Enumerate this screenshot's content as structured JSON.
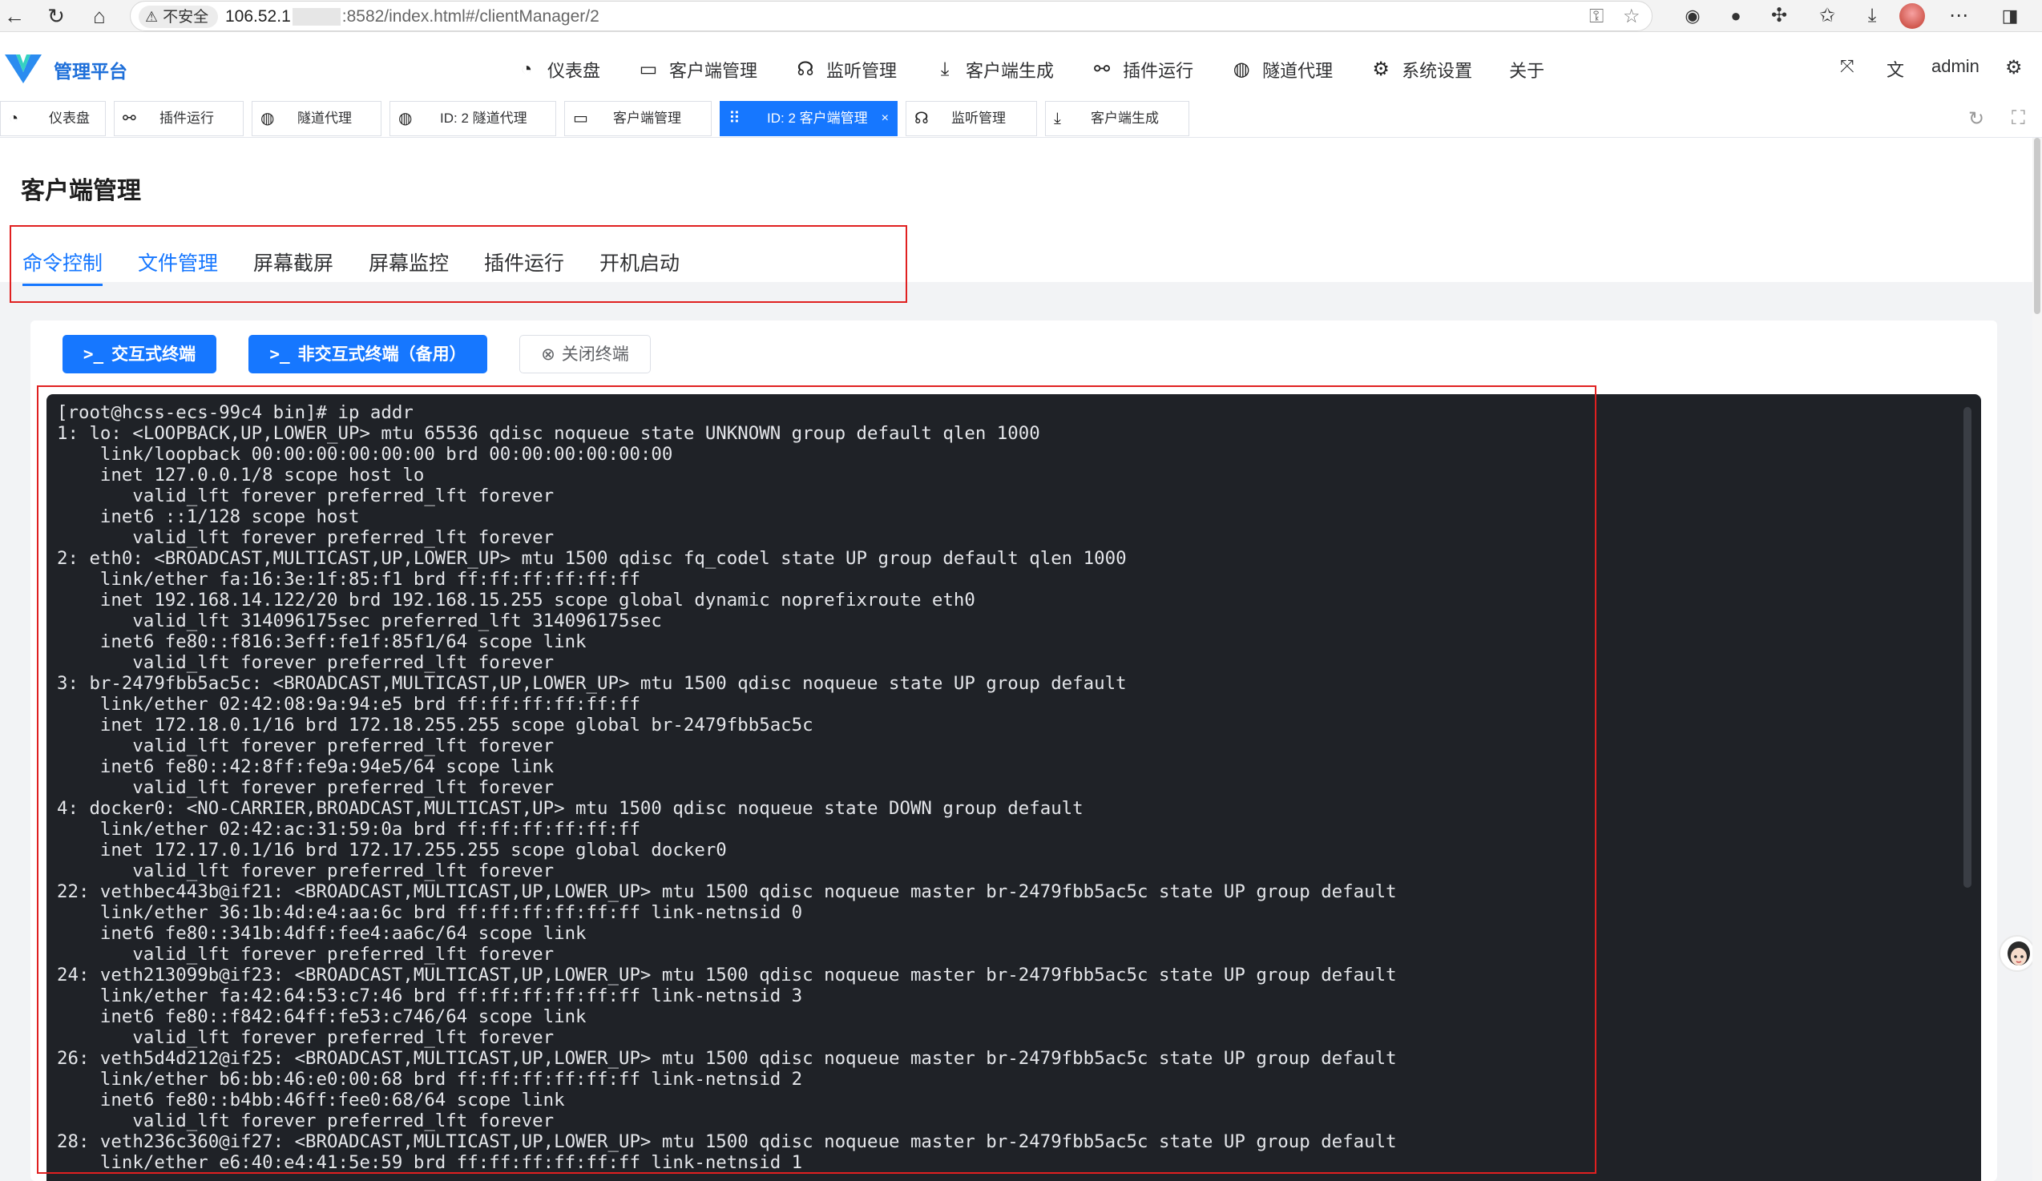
{
  "browser": {
    "security_label": "不安全",
    "url_host": "106.52.1",
    "url_rest": ":8582/index.html#/clientManager/2"
  },
  "header": {
    "app_title": "管理平台",
    "nav": [
      {
        "label": "仪表盘",
        "icon": "dashboard-icon"
      },
      {
        "label": "客户端管理",
        "icon": "monitor-icon"
      },
      {
        "label": "监听管理",
        "icon": "headphones-icon"
      },
      {
        "label": "客户端生成",
        "icon": "download-icon"
      },
      {
        "label": "插件运行",
        "icon": "plug-icon"
      },
      {
        "label": "隧道代理",
        "icon": "globe-icon"
      },
      {
        "label": "系统设置",
        "icon": "gear-icon"
      },
      {
        "label": "关于",
        "icon": ""
      }
    ],
    "user": "admin"
  },
  "tags": [
    {
      "label": "仪表盘",
      "icon": "dashboard-icon"
    },
    {
      "label": "插件运行",
      "icon": "plug-icon"
    },
    {
      "label": "隧道代理",
      "icon": "globe-icon"
    },
    {
      "label": "ID: 2 隧道代理",
      "icon": "globe-icon"
    },
    {
      "label": "客户端管理",
      "icon": "monitor-icon"
    },
    {
      "label": "ID: 2 客户端管理",
      "icon": "grip-icon",
      "active": true,
      "close": "×"
    },
    {
      "label": "监听管理",
      "icon": "headphones-icon"
    },
    {
      "label": "客户端生成",
      "icon": "download-icon"
    }
  ],
  "page": {
    "title": "客户端管理",
    "subtabs": [
      "命令控制",
      "文件管理",
      "屏幕截屏",
      "屏幕监控",
      "插件运行",
      "开机启动"
    ],
    "buttons": {
      "interactive": "交互式终端",
      "non_interactive": "非交互式终端（备用）",
      "close": "关闭终端",
      "prompt_glyph": ">_"
    }
  },
  "terminal": {
    "lines": [
      "[root@hcss-ecs-99c4 bin]# ip addr",
      "1: lo: <LOOPBACK,UP,LOWER_UP> mtu 65536 qdisc noqueue state UNKNOWN group default qlen 1000",
      "    link/loopback 00:00:00:00:00:00 brd 00:00:00:00:00:00",
      "    inet 127.0.0.1/8 scope host lo",
      "       valid_lft forever preferred_lft forever",
      "    inet6 ::1/128 scope host",
      "       valid_lft forever preferred_lft forever",
      "2: eth0: <BROADCAST,MULTICAST,UP,LOWER_UP> mtu 1500 qdisc fq_codel state UP group default qlen 1000",
      "    link/ether fa:16:3e:1f:85:f1 brd ff:ff:ff:ff:ff:ff",
      "    inet 192.168.14.122/20 brd 192.168.15.255 scope global dynamic noprefixroute eth0",
      "       valid_lft 314096175sec preferred_lft 314096175sec",
      "    inet6 fe80::f816:3eff:fe1f:85f1/64 scope link",
      "       valid_lft forever preferred_lft forever",
      "3: br-2479fbb5ac5c: <BROADCAST,MULTICAST,UP,LOWER_UP> mtu 1500 qdisc noqueue state UP group default",
      "    link/ether 02:42:08:9a:94:e5 brd ff:ff:ff:ff:ff:ff",
      "    inet 172.18.0.1/16 brd 172.18.255.255 scope global br-2479fbb5ac5c",
      "       valid_lft forever preferred_lft forever",
      "    inet6 fe80::42:8ff:fe9a:94e5/64 scope link",
      "       valid_lft forever preferred_lft forever",
      "4: docker0: <NO-CARRIER,BROADCAST,MULTICAST,UP> mtu 1500 qdisc noqueue state DOWN group default",
      "    link/ether 02:42:ac:31:59:0a brd ff:ff:ff:ff:ff:ff",
      "    inet 172.17.0.1/16 brd 172.17.255.255 scope global docker0",
      "       valid_lft forever preferred_lft forever",
      "22: vethbec443b@if21: <BROADCAST,MULTICAST,UP,LOWER_UP> mtu 1500 qdisc noqueue master br-2479fbb5ac5c state UP group default",
      "    link/ether 36:1b:4d:e4:aa:6c brd ff:ff:ff:ff:ff:ff link-netnsid 0",
      "    inet6 fe80::341b:4dff:fee4:aa6c/64 scope link",
      "       valid_lft forever preferred_lft forever",
      "24: veth213099b@if23: <BROADCAST,MULTICAST,UP,LOWER_UP> mtu 1500 qdisc noqueue master br-2479fbb5ac5c state UP group default",
      "    link/ether fa:42:64:53:c7:46 brd ff:ff:ff:ff:ff:ff link-netnsid 3",
      "    inet6 fe80::f842:64ff:fe53:c746/64 scope link",
      "       valid_lft forever preferred_lft forever",
      "26: veth5d4d212@if25: <BROADCAST,MULTICAST,UP,LOWER_UP> mtu 1500 qdisc noqueue master br-2479fbb5ac5c state UP group default",
      "    link/ether b6:bb:46:e0:00:68 brd ff:ff:ff:ff:ff:ff link-netnsid 2",
      "    inet6 fe80::b4bb:46ff:fee0:68/64 scope link",
      "       valid_lft forever preferred_lft forever",
      "28: veth236c360@if27: <BROADCAST,MULTICAST,UP,LOWER_UP> mtu 1500 qdisc noqueue master br-2479fbb5ac5c state UP group default",
      "    link/ether e6:40:e4:41:5e:59 brd ff:ff:ff:ff:ff:ff link-netnsid 1"
    ]
  },
  "colors": {
    "primary": "#1677ff",
    "highlight_box": "#e02020",
    "terminal_bg": "#1f2227",
    "terminal_fg": "#e4e6ea"
  }
}
